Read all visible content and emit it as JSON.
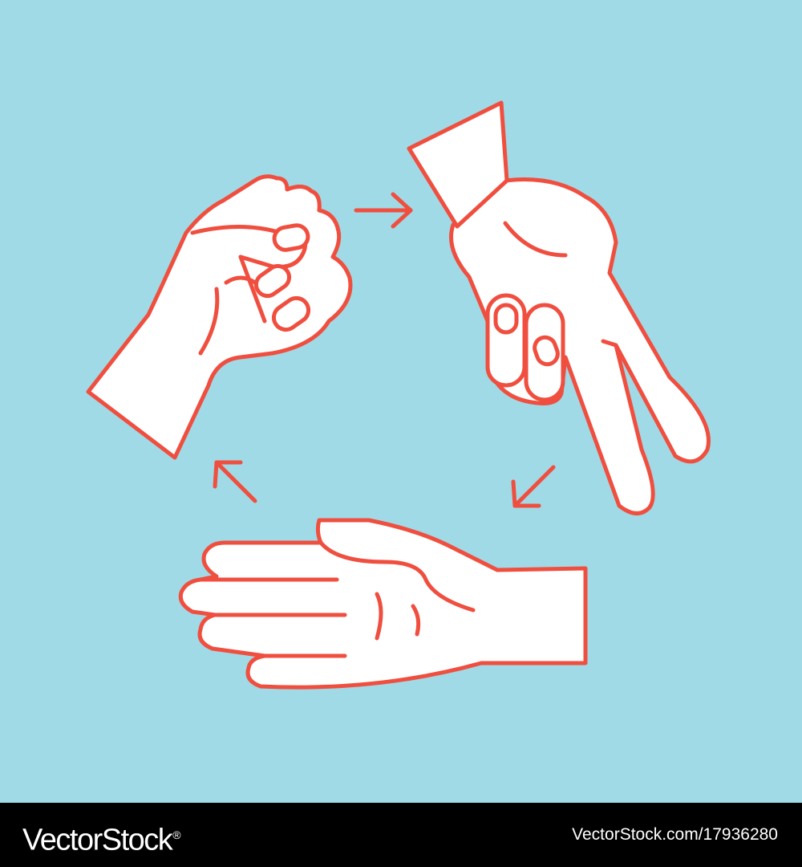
{
  "illustration": {
    "colors": {
      "background": "#a0dae6",
      "outline": "#f04e3e",
      "fill": "#ffffff"
    },
    "figures": [
      "rock-hand",
      "scissors-hand",
      "paper-hand"
    ],
    "arrows": [
      "arrow-right",
      "arrow-down-left",
      "arrow-up-left"
    ]
  },
  "footer": {
    "logo_text": "VectorStock",
    "logo_mark": "®",
    "image_id": "VectorStock.com/17936280"
  }
}
